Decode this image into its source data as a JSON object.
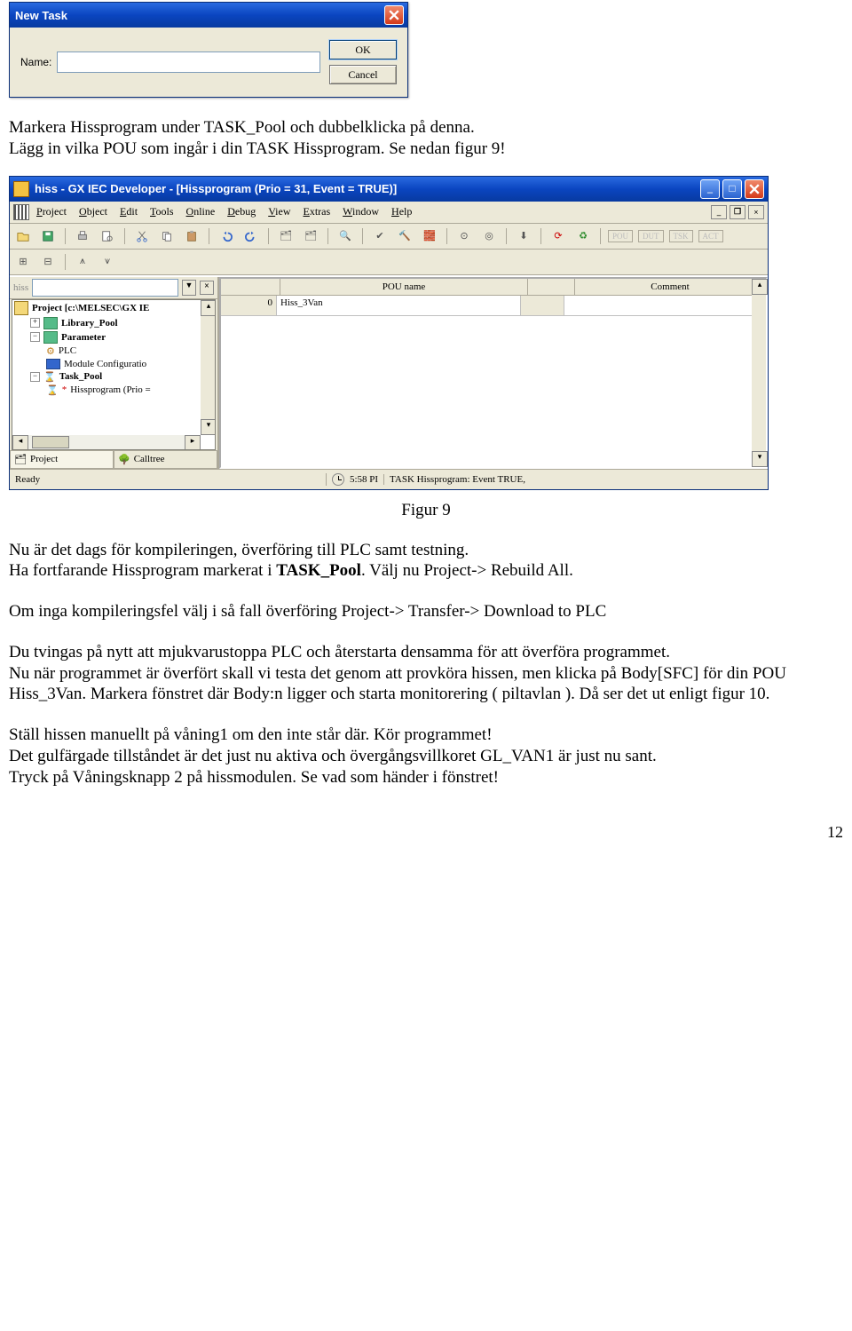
{
  "dialog": {
    "title": "New Task",
    "name_label": "Name:",
    "name_value": "",
    "ok": "OK",
    "cancel": "Cancel"
  },
  "para1": "Markera Hissprogram under TASK_Pool  och dubbelklicka på denna.",
  "para2": "Lägg in vilka POU som ingår i din TASK Hissprogram. Se nedan figur 9!",
  "caption": "Figur 9",
  "para3a": "Nu är det dags för kompileringen, överföring till PLC samt testning.",
  "para3b_pre": "Ha fortfarande Hissprogram markerat i ",
  "para3b_bold": "TASK_Pool",
  "para3b_post": ". Välj nu Project-> Rebuild All.",
  "para4": "Om inga kompileringsfel välj i så fall överföring Project-> Transfer-> Download to PLC",
  "para5": "Du tvingas på nytt att mjukvarustoppa PLC och återstarta densamma för att överföra programmet.",
  "para6": "Nu när programmet är överfört skall vi testa det genom att provköra hissen, men klicka på  Body[SFC] för din POU Hiss_3Van. Markera fönstret där Body:n ligger och starta monitorering ( piltavlan ). Då ser det ut enligt figur 10.",
  "para7": "Ställ hissen manuellt på våning1 om den inte står där. Kör programmet!",
  "para8": "Det gulfärgade tillståndet är det just nu aktiva och övergångsvillkoret GL_VAN1 är just nu sant.",
  "para9": "Tryck på Våningsknapp 2 på hissmodulen. Se vad som händer i fönstret!",
  "page_number": "12",
  "app": {
    "title": "hiss - GX IEC Developer - [Hissprogram (Prio = 31, Event = TRUE)]",
    "menus": [
      "Project",
      "Object",
      "Edit",
      "Tools",
      "Online",
      "Debug",
      "View",
      "Extras",
      "Window",
      "Help"
    ],
    "labels": [
      "POU",
      "DUT",
      "TSK",
      "ACT"
    ],
    "combo_label": "hiss",
    "tree": {
      "project": "Project [c:\\MELSEC\\GX IE",
      "library": "Library_Pool",
      "parameter": "Parameter",
      "plc": "PLC",
      "module": "Module Configuratio",
      "taskpool": "Task_Pool",
      "hissprog": "Hissprogram (Prio ="
    },
    "tabs": {
      "project": "Project",
      "calltree": "Calltree"
    },
    "grid": {
      "headers": {
        "pou": "POU name",
        "comment": "Comment"
      },
      "row_index": "0",
      "pou_name": "Hiss_3Van",
      "comment": ""
    },
    "status": {
      "ready": "Ready",
      "time": "5:58 PI",
      "task": "TASK Hissprogram: Event TRUE,"
    }
  }
}
